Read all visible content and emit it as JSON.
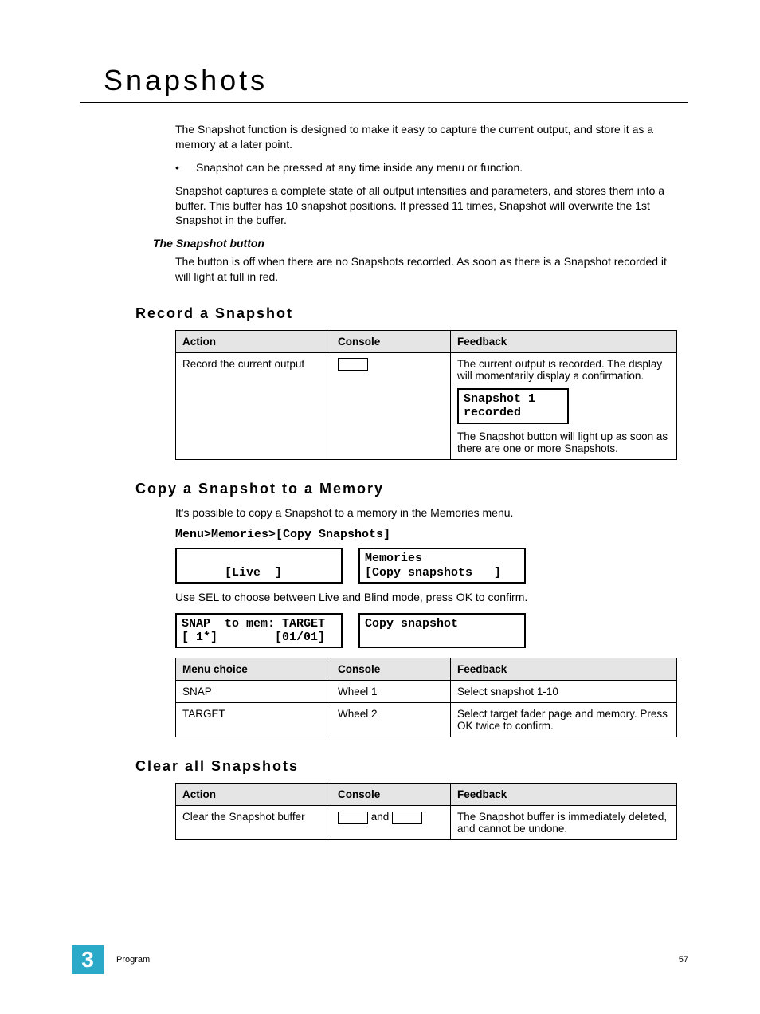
{
  "title": "Snapshots",
  "intro": {
    "p1": "The Snapshot function is designed to make it easy to capture the current output, and store it as a memory at a later point.",
    "bullet": "Snapshot can be pressed at any time inside any menu or function.",
    "p2": "Snapshot captures a complete state of all output intensities and parameters, and stores them into a buffer. This buffer has 10 snapshot positions. If pressed 11 times, Snapshot will overwrite the 1st Snapshot in the buffer.",
    "sub_hdr": "The Snapshot button",
    "p3": "The button is off when there are no Snapshots recorded. As soon as there is a Snapshot recorded it will light at full in red."
  },
  "record": {
    "heading": "Record a Snapshot",
    "cols": [
      "Action",
      "Console",
      "Feedback"
    ],
    "row": {
      "action": "Record the current output",
      "fb1": "The current output is recorded. The display will momentarily display a confirmation.",
      "lcd": "Snapshot 1\nrecorded",
      "fb2": "The Snapshot button will light up as soon as there are one or more Snapshots."
    }
  },
  "copy": {
    "heading": "Copy a Snapshot to a Memory",
    "intro": "It's possible to copy a Snapshot to a memory in the Memories menu.",
    "menu_path": "Menu>Memories>[Copy Snapshots]",
    "lcd_a_left": "\n      [Live  ]",
    "lcd_a_right": "Memories\n[Copy snapshots   ]",
    "mid": "Use SEL to choose between Live and Blind mode, press OK to confirm.",
    "lcd_b_left": "SNAP  to mem: TARGET\n[ 1*]        [01/01]",
    "lcd_b_right": "Copy snapshot\n",
    "cols2": [
      "Menu choice",
      "Console",
      "Feedback"
    ],
    "rows2": [
      {
        "m": "SNAP",
        "c": "Wheel 1",
        "f": "Select snapshot 1-10"
      },
      {
        "m": "TARGET",
        "c": "Wheel 2",
        "f": "Select target fader page and memory. Press OK twice to confirm."
      }
    ]
  },
  "clear": {
    "heading": "Clear all Snapshots",
    "cols": [
      "Action",
      "Console",
      "Feedback"
    ],
    "row": {
      "action": "Clear the Snapshot buffer",
      "and": "and",
      "fb": "The Snapshot buffer is immediately deleted, and cannot be undone."
    }
  },
  "footer": {
    "chapter_num": "3",
    "chapter_name": "Program",
    "page_num": "57"
  }
}
